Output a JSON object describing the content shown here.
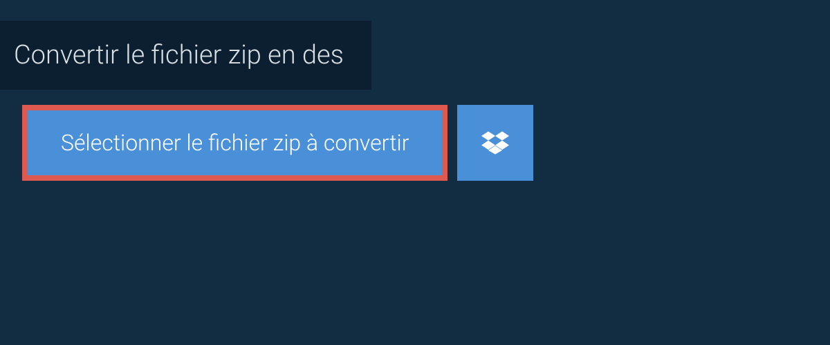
{
  "header": {
    "title": "Convertir le fichier zip en des"
  },
  "actions": {
    "select_label": "Sélectionner le fichier zip à convertir",
    "dropbox_label": "Dropbox"
  },
  "colors": {
    "background": "#122c42",
    "header_bg": "#0c1f30",
    "button_bg": "#4a90d9",
    "highlight_border": "#de5a51",
    "text_light": "#d8e0e6"
  }
}
